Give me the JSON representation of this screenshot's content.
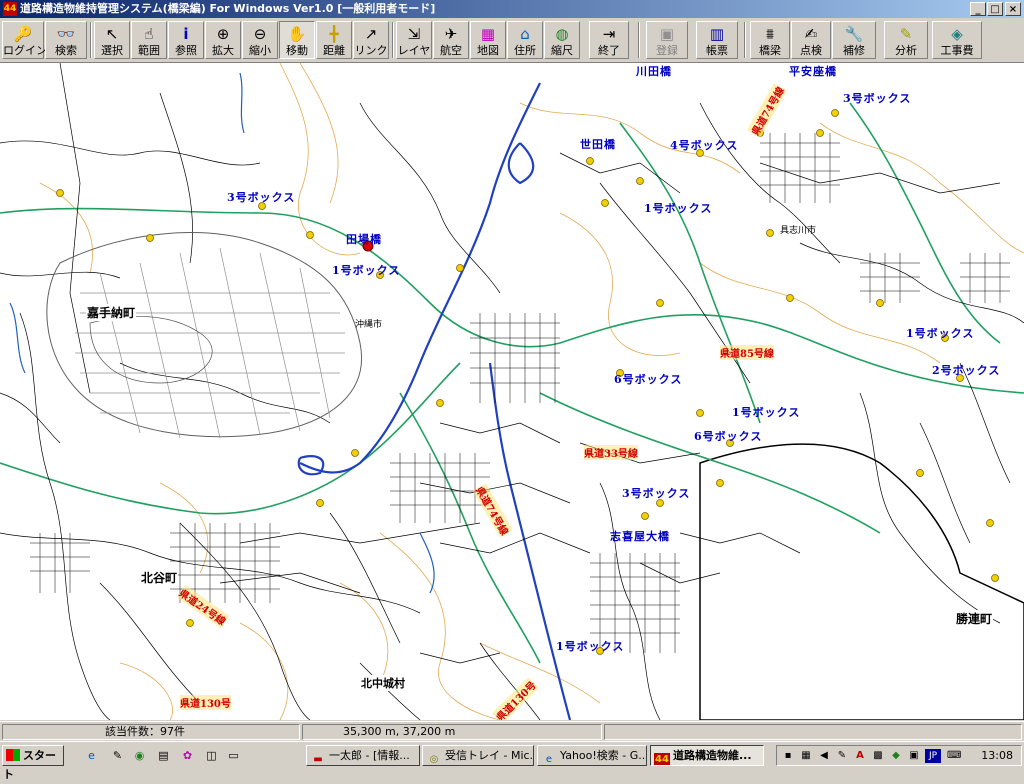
{
  "window": {
    "title": "道路構造物維持管理システム(橋梁編) For Windows Ver1.0 [一般利用者モード]",
    "app_icon": "44",
    "buttons": [
      "minimize",
      "maximize",
      "close"
    ]
  },
  "toolbar": {
    "login": "ログイン",
    "search": "検索",
    "select": "選択",
    "range": "範囲",
    "reference": "参照",
    "zoom_in": "拡大",
    "zoom_out": "縮小",
    "move": "移動",
    "distance": "距離",
    "link": "リンク",
    "layer": "レイヤ",
    "aerial": "航空",
    "map": "地図",
    "address": "住所",
    "scale": "縮尺",
    "exit": "終了",
    "register": "登録",
    "ledger": "帳票",
    "bridge": "橋梁",
    "inspection": "点検",
    "repair": "補修",
    "analysis": "分析",
    "construction_cost": "工事費"
  },
  "map": {
    "blue_labels": [
      "川田橋",
      "平安座橋",
      "3号ボックス",
      "世田橋",
      "4号ボックス",
      "3号ボックス",
      "1号ボックス",
      "1号ボックス",
      "1号ボックス",
      "2号ボックス",
      "6号ボックス",
      "1号ボックス",
      "6号ボックス",
      "3号ボックス",
      "志喜屋大橋",
      "1号ボックス"
    ],
    "red_labels": [
      "県道74号線",
      "県道33号線",
      "県道24号線",
      "県道130号",
      "県道130号",
      "県道85号線",
      "県道74号線"
    ],
    "place_names": [
      "嘉手納町",
      "北谷町",
      "勝連町",
      "北中城村",
      "沖縄市",
      "具志川市"
    ],
    "selected_bridge": "田場橋"
  },
  "status": {
    "count": "該当件数：97件",
    "coordinates": "35,300 m, 37,200 m"
  },
  "taskbar": {
    "start": "スタート",
    "tasks": [
      "一太郎 - [情報...",
      "受信トレイ - Mic...",
      "Yahoo!検索 - G...",
      "道路構造物維..."
    ],
    "active_index": 3,
    "lang": "JP",
    "clock": "13:08"
  }
}
